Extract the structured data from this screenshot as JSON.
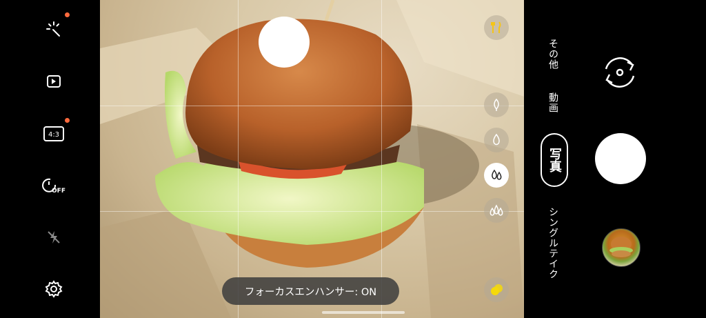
{
  "left_bar": {
    "items": [
      {
        "icon": "magic-effects-icon",
        "has_dot": true
      },
      {
        "icon": "motion-photo-icon",
        "has_dot": false
      },
      {
        "icon": "aspect-ratio-icon",
        "label": "4:3",
        "has_dot": true
      },
      {
        "icon": "timer-icon",
        "label": "OFF",
        "has_dot": false
      },
      {
        "icon": "flash-off-icon",
        "has_dot": false
      },
      {
        "icon": "settings-icon",
        "has_dot": false
      }
    ],
    "dot_color": "#ff6a3d"
  },
  "viewfinder": {
    "food_mode_icon": "fork-knife-icon",
    "lens_buttons": [
      {
        "icon": "single-leaf-icon",
        "active": false
      },
      {
        "icon": "single-drop-icon",
        "active": false
      },
      {
        "icon": "double-drop-icon",
        "active": true
      },
      {
        "icon": "triple-drop-icon",
        "active": false
      }
    ],
    "color_icon": "color-tone-icon",
    "toast": "フォーカスエンハンサー: ON"
  },
  "modes": {
    "more": "その他",
    "video": "動画",
    "photo": "写真",
    "single_take": "シングルテイク"
  },
  "controls": {
    "switch_camera_icon": "switch-camera-icon",
    "shutter_icon": "shutter-button",
    "thumbnail_icon": "gallery-thumbnail"
  }
}
